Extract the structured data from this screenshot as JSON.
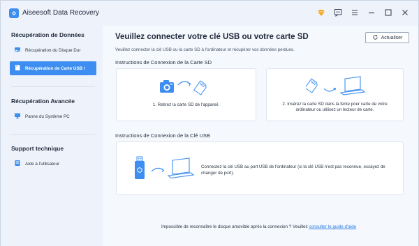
{
  "app": {
    "title": "Aiseesoft Data Recovery"
  },
  "titlebar": {
    "icons": [
      "diamond-icon",
      "chat-icon",
      "menu-icon",
      "minimize-icon",
      "maximize-icon",
      "close-icon"
    ]
  },
  "sidebar": {
    "sections": [
      {
        "heading": "Récupération de Données",
        "items": [
          {
            "label": "Récupération du Disque Dur",
            "icon": "hard-drive-icon",
            "active": false
          },
          {
            "label": "Récupération de Carte USB /",
            "icon": "sd-card-icon",
            "active": true
          }
        ]
      },
      {
        "heading": "Récupération Avancée",
        "items": [
          {
            "label": "Panne du Système PC",
            "icon": "pc-monitor-icon",
            "active": false
          }
        ]
      },
      {
        "heading": "Support technique",
        "items": [
          {
            "label": "Aide à l'utilisateur",
            "icon": "help-book-icon",
            "active": false
          }
        ]
      }
    ]
  },
  "main": {
    "title": "Veuillez connecter votre clé USB ou votre carte SD",
    "subtitle": "Veuillez connecter la clé USB ou la carte SD à l'ordinateur et récupérer vos données perdues.",
    "refresh_label": "Actualiser",
    "sd_section": {
      "label": "Instructions de Connexion de la Carte SD",
      "step1": "1. Retirez la carte SD de l'appareil.",
      "step2_line1": "2. Insérez la carte SD dans la fente pour carte de votre",
      "step2_line2": "ordinateur ou utilisez un lecteur de carte."
    },
    "usb_section": {
      "label": "Instructions de Connexion de la Clé USB",
      "text_line1": "Connectez la clé USB au port USB de l'ordinateur (si la clé USB n'est pas reconnue, essayez de",
      "text_line2": "changer de port)."
    },
    "footer": {
      "text": "Impossible de reconnaître le disque amovible après la connexion ? Veuillez ",
      "link": "consulter le guide d'aide"
    }
  },
  "colors": {
    "accent": "#3d8ef0",
    "sidebar_bg": "#eef3fb",
    "main_bg": "#f5f8fd",
    "link": "#2b7de0"
  }
}
